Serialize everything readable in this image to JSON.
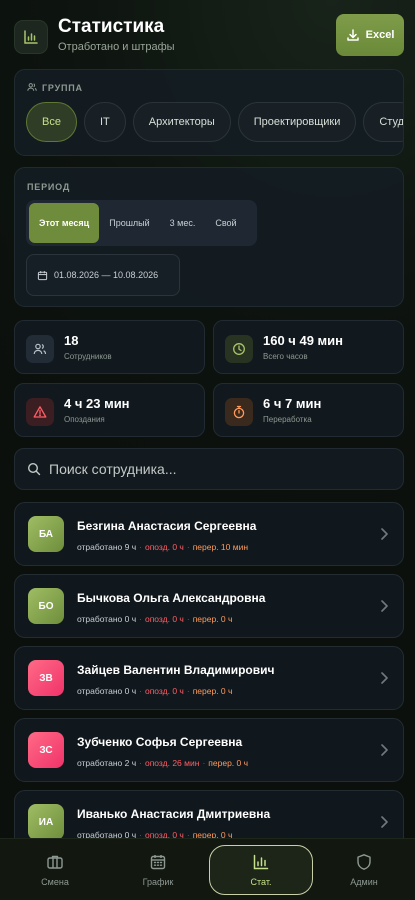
{
  "header": {
    "title": "Статистика",
    "subtitle": "Отработано и штрафы",
    "excel_label": "Excel"
  },
  "group": {
    "label": "ГРУППА",
    "chips": [
      "Все",
      "IT",
      "Архитекторы",
      "Проектировщики",
      "Студ"
    ],
    "selected": "Все"
  },
  "period": {
    "label": "ПЕРИОД",
    "options": [
      "Этот месяц",
      "Прошлый",
      "3 мес.",
      "Свой"
    ],
    "selected": "Этот месяц",
    "range": "01.08.2026 — 10.08.2026"
  },
  "stats": [
    {
      "value": "18",
      "label": "Сотрудников",
      "icon": "users-icon"
    },
    {
      "value": "160 ч 49 мин",
      "label": "Всего часов",
      "icon": "clock-icon"
    },
    {
      "value": "4 ч 23 мин",
      "label": "Опоздания",
      "icon": "warning-icon"
    },
    {
      "value": "6 ч 7 мин",
      "label": "Переработка",
      "icon": "stopwatch-icon"
    }
  ],
  "search": {
    "placeholder": "Поиск сотрудника..."
  },
  "employees": [
    {
      "initials": "БА",
      "name": "Безгина Анастасия Сергеевна",
      "worked": "отработано 9 ч",
      "late": "опозд. 0 ч",
      "over": "перер. 10 мин",
      "color": "green"
    },
    {
      "initials": "БО",
      "name": "Бычкова Ольга Александровна",
      "worked": "отработано 0 ч",
      "late": "опозд. 0 ч",
      "over": "перер. 0 ч",
      "color": "green"
    },
    {
      "initials": "ЗВ",
      "name": "Зайцев Валентин Владимирович",
      "worked": "отработано 0 ч",
      "late": "опозд. 0 ч",
      "over": "перер. 0 ч",
      "color": "pink"
    },
    {
      "initials": "ЗС",
      "name": "Зубченко Софья Сергеевна",
      "worked": "отработано 2 ч",
      "late": "опозд. 26 мин",
      "over": "перер. 0 ч",
      "color": "pink"
    },
    {
      "initials": "ИА",
      "name": "Иванько Анастасия Дмитриевна",
      "worked": "отработано 0 ч",
      "late": "опозд. 0 ч",
      "over": "перер. 0 ч",
      "color": "green"
    }
  ],
  "nav": [
    {
      "label": "Смена",
      "icon": "briefcase-icon"
    },
    {
      "label": "График",
      "icon": "calendar-icon"
    },
    {
      "label": "Стат.",
      "icon": "bar-chart-icon",
      "active": true
    },
    {
      "label": "Админ",
      "icon": "shield-icon"
    }
  ],
  "colors": {
    "accent": "#6e8c3b",
    "late": "#ff5d64",
    "over": "#ff9a5a"
  }
}
